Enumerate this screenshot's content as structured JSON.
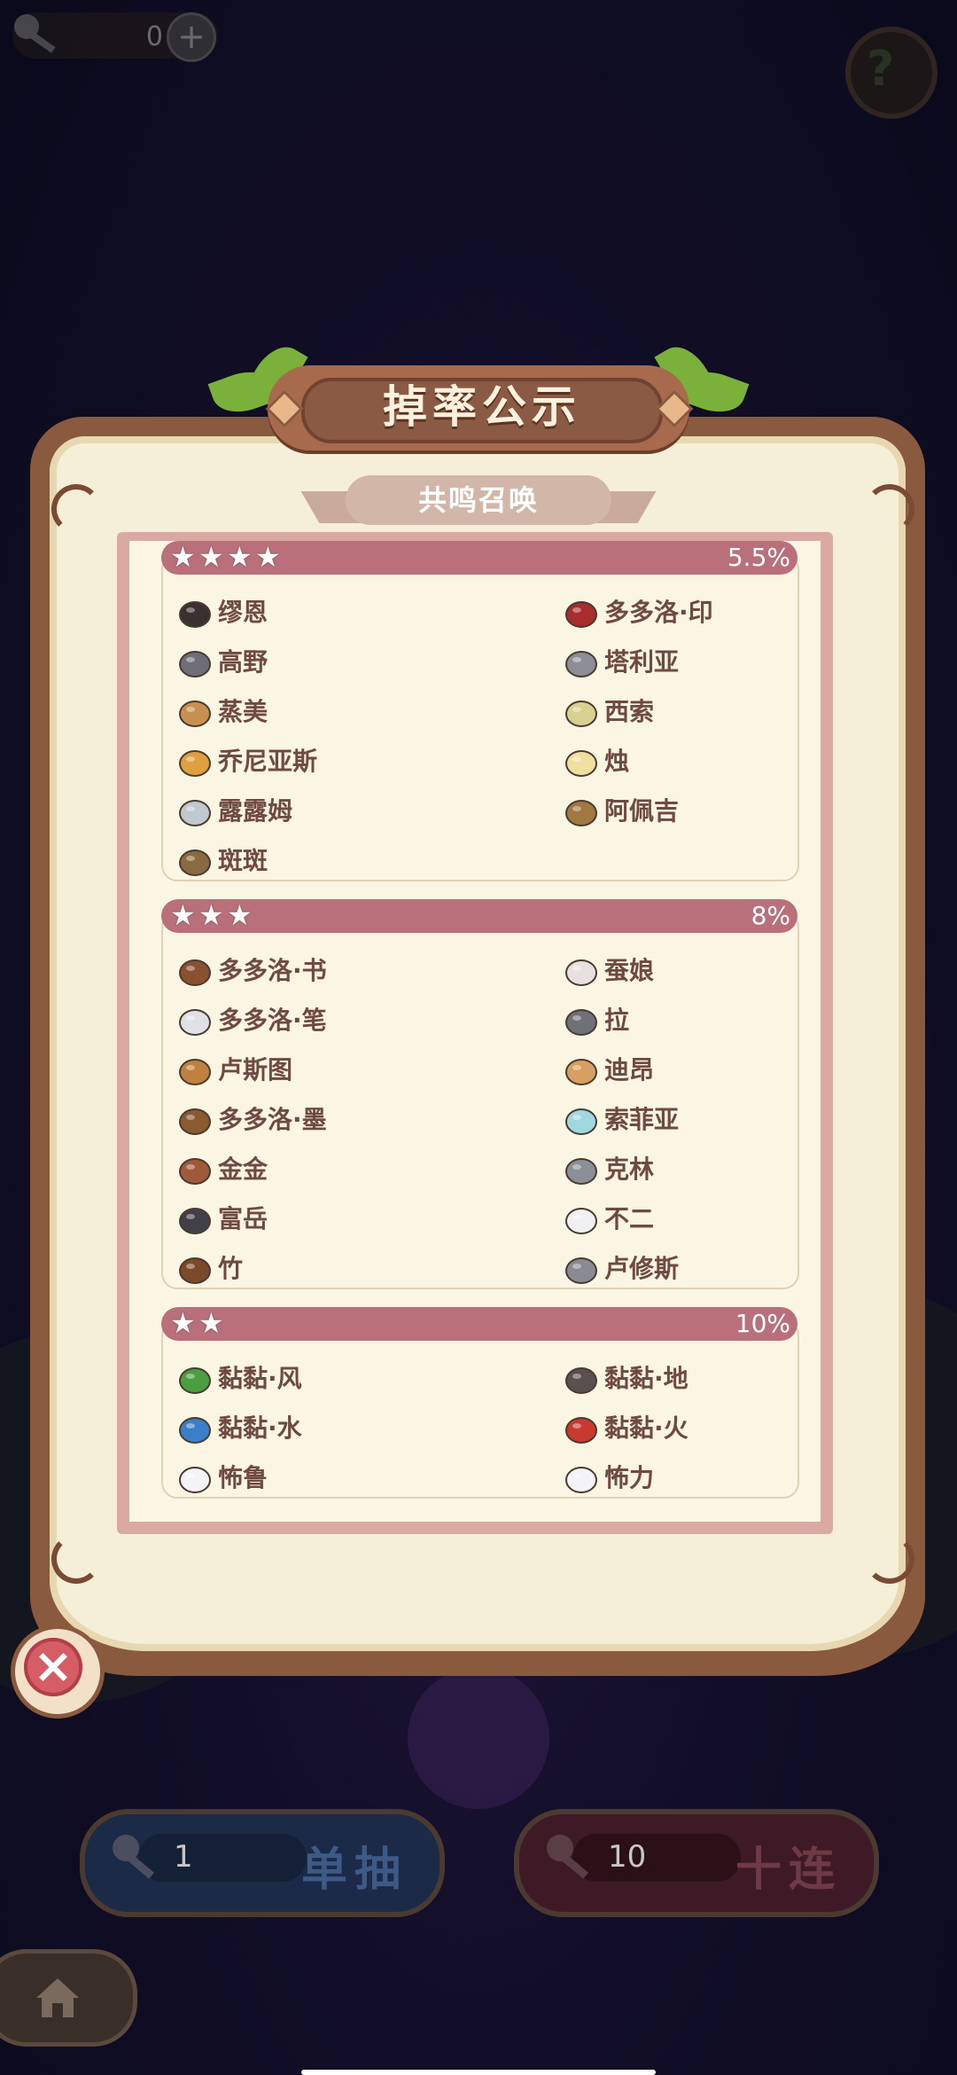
{
  "currency": {
    "amount": "0",
    "plus_label": "+"
  },
  "panel": {
    "title": "掉率公示",
    "subtitle": "共鸣召唤"
  },
  "sections": [
    {
      "stars": 4,
      "rate": "5.5%",
      "items": [
        {
          "name": "缪恩",
          "icon": "chess-king-icon"
        },
        {
          "name": "多多洛·印",
          "icon": "seal-stamp-icon"
        },
        {
          "name": "高野",
          "icon": "hammer-icon"
        },
        {
          "name": "塔利亚",
          "icon": "knife-icon"
        },
        {
          "name": "蒸美",
          "icon": "steamer-basket-icon"
        },
        {
          "name": "西索",
          "icon": "tape-roll-icon"
        },
        {
          "name": "乔尼亚斯",
          "icon": "fruit-pile-icon"
        },
        {
          "name": "烛",
          "icon": "candle-icon"
        },
        {
          "name": "露露姆",
          "icon": "test-tube-icon"
        },
        {
          "name": "阿佩吉",
          "icon": "glasses-icon"
        },
        {
          "name": "斑斑",
          "icon": "wood-log-icon"
        }
      ]
    },
    {
      "stars": 3,
      "rate": "8%",
      "items": [
        {
          "name": "多多洛·书",
          "icon": "book-icon"
        },
        {
          "name": "蚕娘",
          "icon": "thread-spool-icon"
        },
        {
          "name": "多多洛·笔",
          "icon": "feather-quill-icon"
        },
        {
          "name": "拉",
          "icon": "film-canister-icon"
        },
        {
          "name": "卢斯图",
          "icon": "scroll-icon"
        },
        {
          "name": "迪昂",
          "icon": "cookie-icon"
        },
        {
          "name": "多多洛·墨",
          "icon": "ink-pot-icon"
        },
        {
          "name": "索菲亚",
          "icon": "teacup-icon"
        },
        {
          "name": "金金",
          "icon": "treasure-chest-icon"
        },
        {
          "name": "克林",
          "icon": "watering-can-icon"
        },
        {
          "name": "富岳",
          "icon": "bomb-icon"
        },
        {
          "name": "不二",
          "icon": "snowball-icon"
        },
        {
          "name": "竹",
          "icon": "bamboo-stick-icon"
        },
        {
          "name": "卢修斯",
          "icon": "fork-icon"
        }
      ]
    },
    {
      "stars": 2,
      "rate": "10%",
      "items": [
        {
          "name": "黏黏·风",
          "icon": "green-slime-icon"
        },
        {
          "name": "黏黏·地",
          "icon": "gray-slime-icon"
        },
        {
          "name": "黏黏·水",
          "icon": "blue-slime-icon"
        },
        {
          "name": "黏黏·火",
          "icon": "red-slime-icon"
        },
        {
          "name": "怖鲁",
          "icon": "ghost-fish-icon"
        },
        {
          "name": "怖力",
          "icon": "ghost-fish-icon"
        }
      ]
    }
  ],
  "buttons": {
    "single": {
      "count": "1",
      "label": "单抽"
    },
    "multi": {
      "count": "10",
      "label": "十连"
    }
  },
  "colors": {
    "header_bar": "#b9707a",
    "panel_bg": "#f6efd8",
    "item_text": "#6e4a40",
    "close": "#d65c66"
  }
}
